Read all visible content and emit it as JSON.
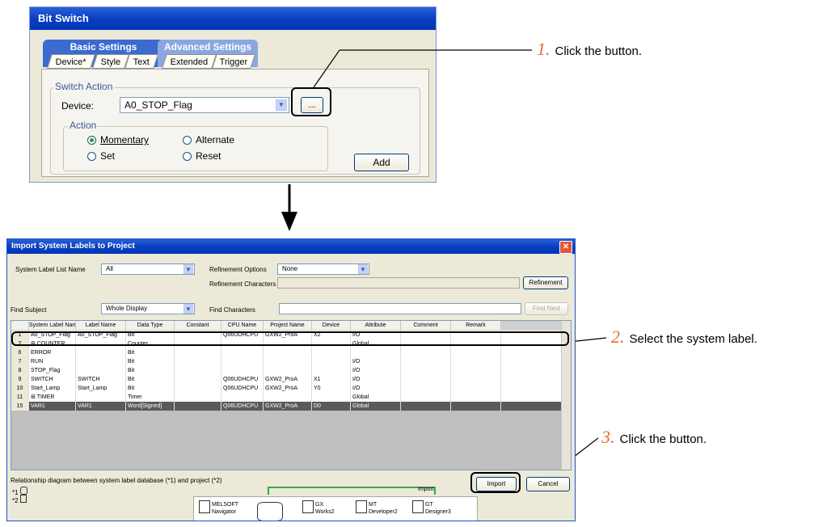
{
  "bitswitch": {
    "title": "Bit Switch",
    "tab_group_basic": "Basic Settings",
    "tab_group_advanced": "Advanced Settings",
    "tabs": [
      "Device*",
      "Style",
      "Text",
      "Extended",
      "Trigger"
    ],
    "switch_action_label": "Switch Action",
    "device_label": "Device:",
    "device_value": "A0_STOP_Flag",
    "browse_label": "...",
    "action_label": "Action",
    "radios": [
      "Momentary",
      "Alternate",
      "Set",
      "Reset"
    ],
    "selected_radio": "Momentary",
    "add_label": "Add"
  },
  "import_dialog": {
    "title": "Import System Labels to Project",
    "system_label_list_name_label": "System Label List Name",
    "system_label_list_name_value": "All",
    "refinement_options_label": "Refinement Options",
    "refinement_options_value": "None",
    "refinement_characters_label": "Refinement Characters",
    "refinement_button": "Refinement",
    "find_subject_label": "Find Subject",
    "find_subject_value": "Whole Display",
    "find_characters_label": "Find Characters",
    "find_next_button": "Find Next",
    "columns": [
      "",
      "System Label Name",
      "Label Name",
      "Data Type",
      "Constant",
      "CPU Name",
      "Project Name",
      "Device",
      "Attribute",
      "Comment",
      "Remark"
    ],
    "rows": [
      {
        "no": "1",
        "name": "A0_STOP_Flag",
        "label": "A0_STOP_Flag",
        "type": "Bit",
        "const": "",
        "cpu": "Q06UDHCPU",
        "project": "GXW2_ProA",
        "device": "X2",
        "attr": "I/O"
      },
      {
        "no": "2",
        "name": "COUNTER",
        "label": "",
        "type": "Counter",
        "const": "",
        "cpu": "",
        "project": "",
        "device": "",
        "attr": "Global"
      },
      {
        "no": "6",
        "name": "ERROR",
        "label": "",
        "type": "Bit",
        "const": "",
        "cpu": "",
        "project": "",
        "device": "",
        "attr": ""
      },
      {
        "no": "7",
        "name": "RUN",
        "label": "",
        "type": "Bit",
        "const": "",
        "cpu": "",
        "project": "",
        "device": "",
        "attr": "I/O"
      },
      {
        "no": "8",
        "name": "STOP_Flag",
        "label": "",
        "type": "Bit",
        "const": "",
        "cpu": "",
        "project": "",
        "device": "",
        "attr": "I/O"
      },
      {
        "no": "9",
        "name": "SWITCH",
        "label": "SWITCH",
        "type": "Bit",
        "const": "",
        "cpu": "Q06UDHCPU",
        "project": "GXW2_ProA",
        "device": "X1",
        "attr": "I/O"
      },
      {
        "no": "10",
        "name": "Start_Lamp",
        "label": "Start_Lamp",
        "type": "Bit",
        "const": "",
        "cpu": "Q06UDHCPU",
        "project": "GXW2_ProA",
        "device": "Y0",
        "attr": "I/O"
      },
      {
        "no": "11",
        "name": "TIMER",
        "label": "",
        "type": "Timer",
        "const": "",
        "cpu": "",
        "project": "",
        "device": "",
        "attr": "Global"
      },
      {
        "no": "15",
        "name": "VAR1",
        "label": "VAR1",
        "type": "Word[Signed]",
        "const": "",
        "cpu": "Q06UDHCPU",
        "project": "GXW2_ProA",
        "device": "D0",
        "attr": "Global"
      }
    ],
    "relationship_label": "Relationship diagram between system label database (*1) and project (*2)",
    "legend1": "*1",
    "legend2": "*2",
    "import_label": "Import",
    "import_button": "Import",
    "cancel_button": "Cancel",
    "apps": [
      {
        "line1": "MELSOFT",
        "line2": "Navigator"
      },
      {
        "line1": "GX",
        "line2": "Works2"
      },
      {
        "line1": "MT",
        "line2": "Developer2"
      },
      {
        "line1": "GT",
        "line2": "Designer3"
      }
    ]
  },
  "steps": [
    {
      "num": "1.",
      "text": "Click the button."
    },
    {
      "num": "2.",
      "text": "Select the system label."
    },
    {
      "num": "3.",
      "text": "Click the button."
    }
  ],
  "colors": {
    "step_number": "#e46b2b",
    "titlebar": "#0a3fc0",
    "selected_row": "#5a5a5a"
  }
}
